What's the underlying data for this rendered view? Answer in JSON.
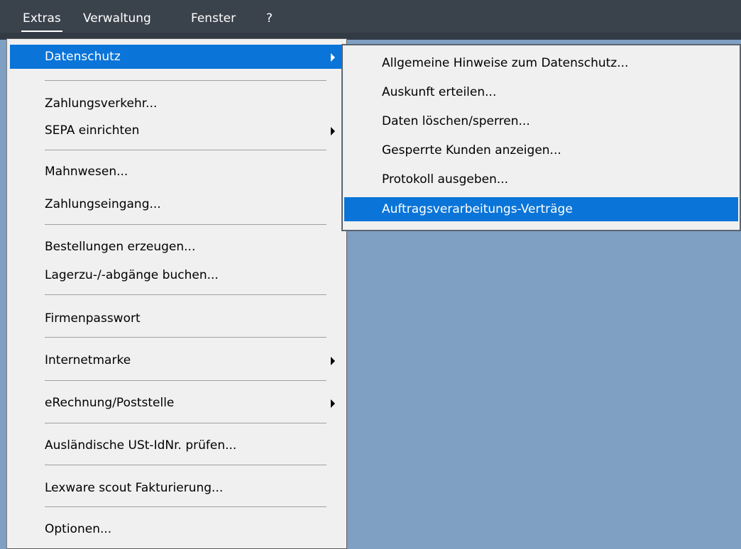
{
  "menubar": {
    "items": [
      {
        "label": "Extras"
      },
      {
        "label": "Verwaltung"
      },
      {
        "label": "Fenster"
      },
      {
        "label": "?"
      }
    ]
  },
  "extras_menu": {
    "items": [
      {
        "label": "Datenschutz",
        "submenu": true
      },
      {
        "label": "Zahlungsverkehr..."
      },
      {
        "label": "SEPA einrichten",
        "submenu": true
      },
      {
        "label": "Mahnwesen..."
      },
      {
        "label": "Zahlungseingang..."
      },
      {
        "label": "Bestellungen erzeugen..."
      },
      {
        "label": "Lagerzu-/-abgänge buchen..."
      },
      {
        "label": "Firmenpasswort"
      },
      {
        "label": "Internetmarke",
        "submenu": true
      },
      {
        "label": "eRechnung/Poststelle",
        "submenu": true
      },
      {
        "label": "Ausländische USt-IdNr. prüfen..."
      },
      {
        "label": "Lexware scout Fakturierung..."
      },
      {
        "label": "Optionen..."
      }
    ]
  },
  "datenschutz_submenu": {
    "items": [
      {
        "label": "Allgemeine Hinweise zum Datenschutz..."
      },
      {
        "label": "Auskunft erteilen..."
      },
      {
        "label": "Daten löschen/sperren..."
      },
      {
        "label": "Gesperrte Kunden anzeigen..."
      },
      {
        "label": "Protokoll ausgeben..."
      },
      {
        "label": "Auftragsverarbeitungs-Verträge"
      }
    ]
  },
  "colors": {
    "menubar_bg": "#3a424c",
    "highlight": "#0a74d8",
    "menu_bg": "#f0f0f0",
    "desktop_bg": "#7f9fc3"
  }
}
